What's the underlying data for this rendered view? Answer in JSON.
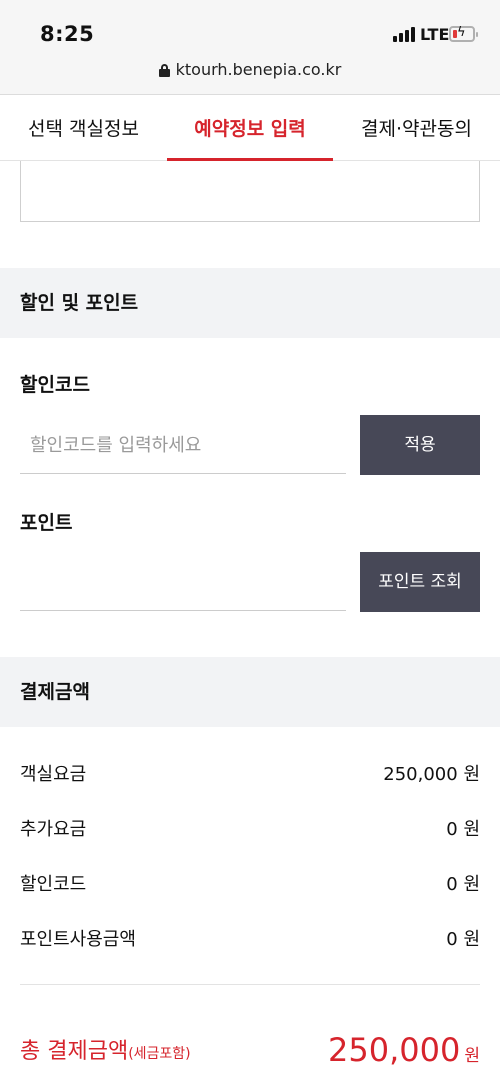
{
  "status": {
    "time": "8:25",
    "network": "LTE",
    "url": "ktourh.benepia.co.kr"
  },
  "tabs": [
    {
      "label": "선택 객실정보"
    },
    {
      "label": "예약정보 입력"
    },
    {
      "label": "결제·약관동의"
    }
  ],
  "discount_section": {
    "header": "할인 및 포인트",
    "code_label": "할인코드",
    "code_placeholder": "할인코드를 입력하세요",
    "code_value": "",
    "apply_button": "적용",
    "point_label": "포인트",
    "point_value": "",
    "point_button": "포인트 조회"
  },
  "payment_section": {
    "header": "결제금액",
    "rows": [
      {
        "label": "객실요금",
        "value": "250,000 원"
      },
      {
        "label": "추가요금",
        "value": "0 원"
      },
      {
        "label": "할인코드",
        "value": "0 원"
      },
      {
        "label": "포인트사용금액",
        "value": "0 원"
      }
    ],
    "total_label": "총 결제금액",
    "total_note": "(세금포함)",
    "total_amount": "250,000",
    "total_unit": "원"
  },
  "colors": {
    "accent": "#d6242c",
    "button": "#474857",
    "section_bg": "#f2f3f5"
  }
}
